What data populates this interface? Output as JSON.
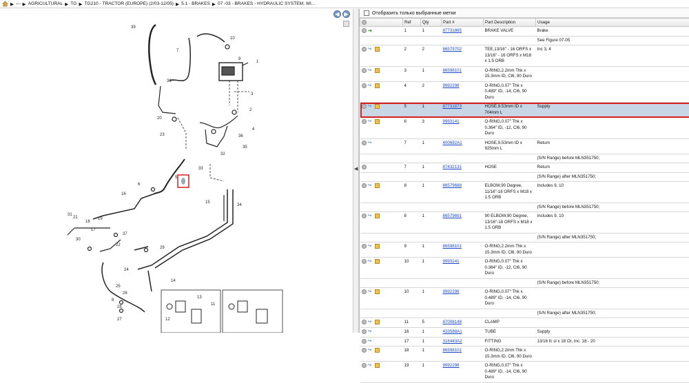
{
  "breadcrumb": {
    "items": [
      "---",
      "AGRICULTURAL",
      "TG",
      "TG210 - TRACTOR (EUROPE) (2/03-12/05)",
      "5.1 - BRAKES",
      "07 -03 - BRAKES - HYDRAULIC SYSTEM, WI..."
    ],
    "separator": "▶"
  },
  "nav": {
    "prev": "◀",
    "next": "▶"
  },
  "splitter": {
    "arrow": "◀"
  },
  "filter": {
    "label": "Отобразить только выбранные метки"
  },
  "table": {
    "headers": [
      "Ref",
      "Qty",
      "Part #",
      "Part Description",
      "Usage"
    ],
    "rows": [
      {
        "icons": "green-arrow",
        "ref": "1",
        "qty": "1",
        "part": "87731865",
        "desc": "BRAKE VALVE",
        "usage": "Brake"
      },
      {
        "icons": "",
        "ref": "",
        "qty": "",
        "part": "",
        "desc": "",
        "usage": "See Figure 07-05"
      },
      {
        "icons": "full",
        "ref": "2",
        "qty": "2",
        "part": "86579702",
        "desc": "TEE,13/16\" - 16 ORFS x 13/16\" - 16 ORFS x M18 x 1.5 ORB",
        "usage": "Inc 3, 4"
      },
      {
        "icons": "full",
        "ref": "3",
        "qty": "1",
        "part": "86598101",
        "desc": "O-RING,2.2mm Thk x 15.3mm ID, Cl6, 90 Duro",
        "usage": ""
      },
      {
        "icons": "full",
        "ref": "4",
        "qty": "2",
        "part": "9992298",
        "desc": "O-RING,0.07\" Thk x 0.489\" ID, -14, Cl6, 90 Duro",
        "usage": ""
      },
      {
        "icons": "full",
        "ref": "5",
        "qty": "1",
        "part": "87731873",
        "desc": "HOSE,9.53mm ID x 704mm L",
        "usage": "Supply",
        "selected": true
      },
      {
        "icons": "full",
        "ref": "6",
        "qty": "3",
        "part": "9993141",
        "desc": "O-RING,0.07\" Thk x 0.364\" ID, -12, Cl6, 90 Duro",
        "usage": ""
      },
      {
        "icons": "arrow",
        "ref": "7",
        "qty": "1",
        "part": "400692A1",
        "desc": "HOSE,9.53mm ID x 925mm L",
        "usage": "Return"
      },
      {
        "icons": "",
        "ref": "",
        "qty": "",
        "part": "",
        "desc": "",
        "usage": "(S/N Range) before MLN351750;"
      },
      {
        "icons": "circle",
        "ref": "7",
        "qty": "1",
        "part": "87432131",
        "desc": "HOSE",
        "usage": "Return"
      },
      {
        "icons": "",
        "ref": "",
        "qty": "",
        "part": "",
        "desc": "",
        "usage": "(S/N Range) after MLN351750;"
      },
      {
        "icons": "full",
        "ref": "8",
        "qty": "1",
        "part": "86579688",
        "desc": "ELBOW,90 Degree, 11/16\"-18 ORFS x M18 x 1.5 ORB",
        "usage": "Includes 9, 10"
      },
      {
        "icons": "",
        "ref": "",
        "qty": "",
        "part": "",
        "desc": "",
        "usage": "(S/N Range) before MLN351750;"
      },
      {
        "icons": "full",
        "ref": "8",
        "qty": "1",
        "part": "86579691",
        "desc": "90 ELBOW,90 Degree, 13/16\"-18 ORFS x M18 x 1.5 ORB",
        "usage": "Includes 9, 10"
      },
      {
        "icons": "",
        "ref": "",
        "qty": "",
        "part": "",
        "desc": "",
        "usage": "(S/N Range) after MLN351750;"
      },
      {
        "icons": "full",
        "ref": "9",
        "qty": "1",
        "part": "86598101",
        "desc": "O-RING,2.2mm Thk x 15.3mm ID, Cl6, 90 Duro",
        "usage": ""
      },
      {
        "icons": "full",
        "ref": "10",
        "qty": "1",
        "part": "9993141",
        "desc": "O-RING,0.07\" Thk x 0.364\" ID, -12, Cl6, 90 Duro",
        "usage": ""
      },
      {
        "icons": "",
        "ref": "",
        "qty": "",
        "part": "",
        "desc": "",
        "usage": "(S/N Range) before MLN351750;"
      },
      {
        "icons": "full",
        "ref": "10",
        "qty": "1",
        "part": "9992298",
        "desc": "O-RING,0.07\" Thk x 0.489\" ID, -14, Cl6, 90 Duro",
        "usage": ""
      },
      {
        "icons": "",
        "ref": "",
        "qty": "",
        "part": "",
        "desc": "",
        "usage": "(S/N Range) after MLN351750;"
      },
      {
        "icons": "full",
        "ref": "11",
        "qty": "5",
        "part": "87008148",
        "desc": "CLAMP",
        "usage": ""
      },
      {
        "icons": "arrow",
        "ref": "16",
        "qty": "1",
        "part": "433588A1",
        "desc": "TUBE",
        "usage": "Supply"
      },
      {
        "icons": "arrow",
        "ref": "17",
        "qty": "1",
        "part": "316443A2",
        "desc": "FITTING",
        "usage": "13/16 fc sl x 18 Or, Inc. 18 - 20"
      },
      {
        "icons": "full",
        "ref": "18",
        "qty": "1",
        "part": "86598101",
        "desc": "O-RING,2.2mm Thk x 15.3mm ID, Cl6, 90 Duro",
        "usage": ""
      },
      {
        "icons": "full",
        "ref": "19",
        "qty": "1",
        "part": "9992298",
        "desc": "O-RING,0.07\" Thk x 0.489\" ID, -14, Cl6, 90 Duro",
        "usage": ""
      }
    ]
  },
  "diagram": {
    "callouts": [
      "1",
      "2",
      "3",
      "4",
      "5",
      "6",
      "7",
      "8",
      "9",
      "10",
      "11",
      "12",
      "13",
      "14",
      "15",
      "16",
      "17",
      "18",
      "19",
      "20",
      "21",
      "22",
      "23",
      "24",
      "25",
      "26",
      "27",
      "28",
      "29",
      "30",
      "31",
      "32",
      "33",
      "34",
      "35",
      "36",
      "37",
      "38",
      "39"
    ]
  }
}
